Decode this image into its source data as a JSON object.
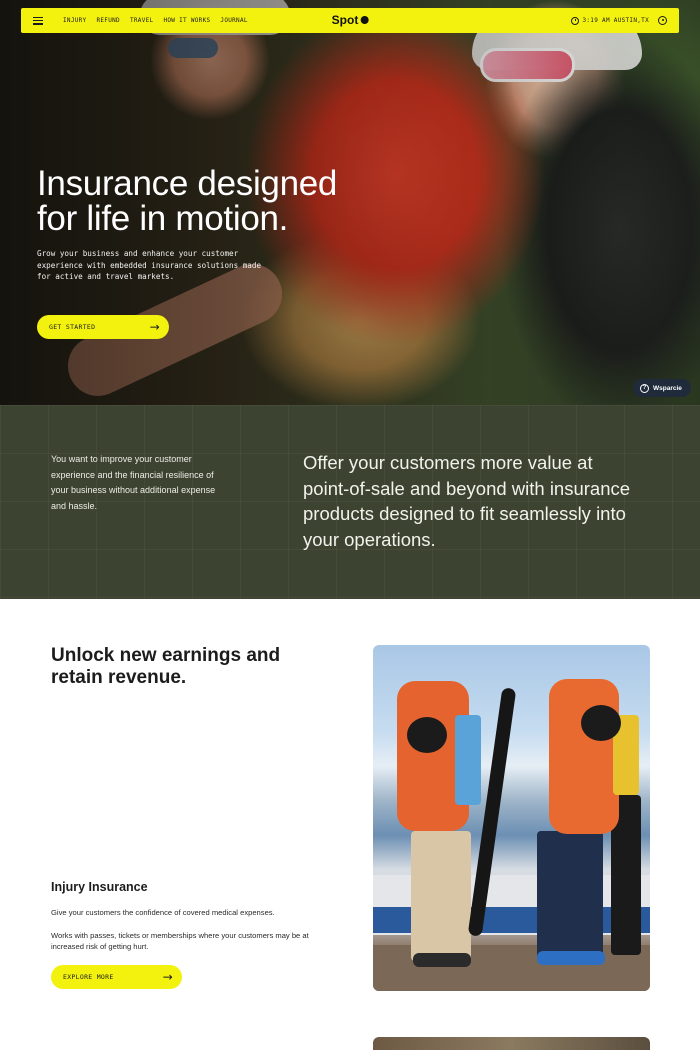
{
  "nav": {
    "links": [
      "INJURY",
      "REFUND",
      "TRAVEL",
      "HOW IT WORKS",
      "JOURNAL"
    ],
    "logo": "Spot",
    "time": "3:19 AM AUSTIN,TX"
  },
  "hero": {
    "title_line1": "Insurance designed",
    "title_line2": "for life in motion.",
    "subtitle": "Grow your business and enhance your customer experience with embedded insurance solutions made for active and travel markets.",
    "cta": "GET STARTED"
  },
  "support": {
    "label": "Wsparcie",
    "icon": "help-icon"
  },
  "value": {
    "left": "You want to improve your customer experience and the financial resilience of your business without additional expense and hassle.",
    "right": "Offer your customers more value at point-of-sale and beyond with insurance products designed to fit seamlessly into your operations."
  },
  "earnings": {
    "title": "Unlock new earnings and retain revenue.",
    "product_title": "Injury Insurance",
    "p1": "Give your customers the confidence of covered medical expenses.",
    "p2": "Works with passes, tickets or memberships where your customers may be at increased risk of getting hurt.",
    "cta": "EXPLORE MORE"
  },
  "colors": {
    "accent": "#f3f20e",
    "olive": "#3d4331",
    "support_bg": "#1f2a3a"
  }
}
